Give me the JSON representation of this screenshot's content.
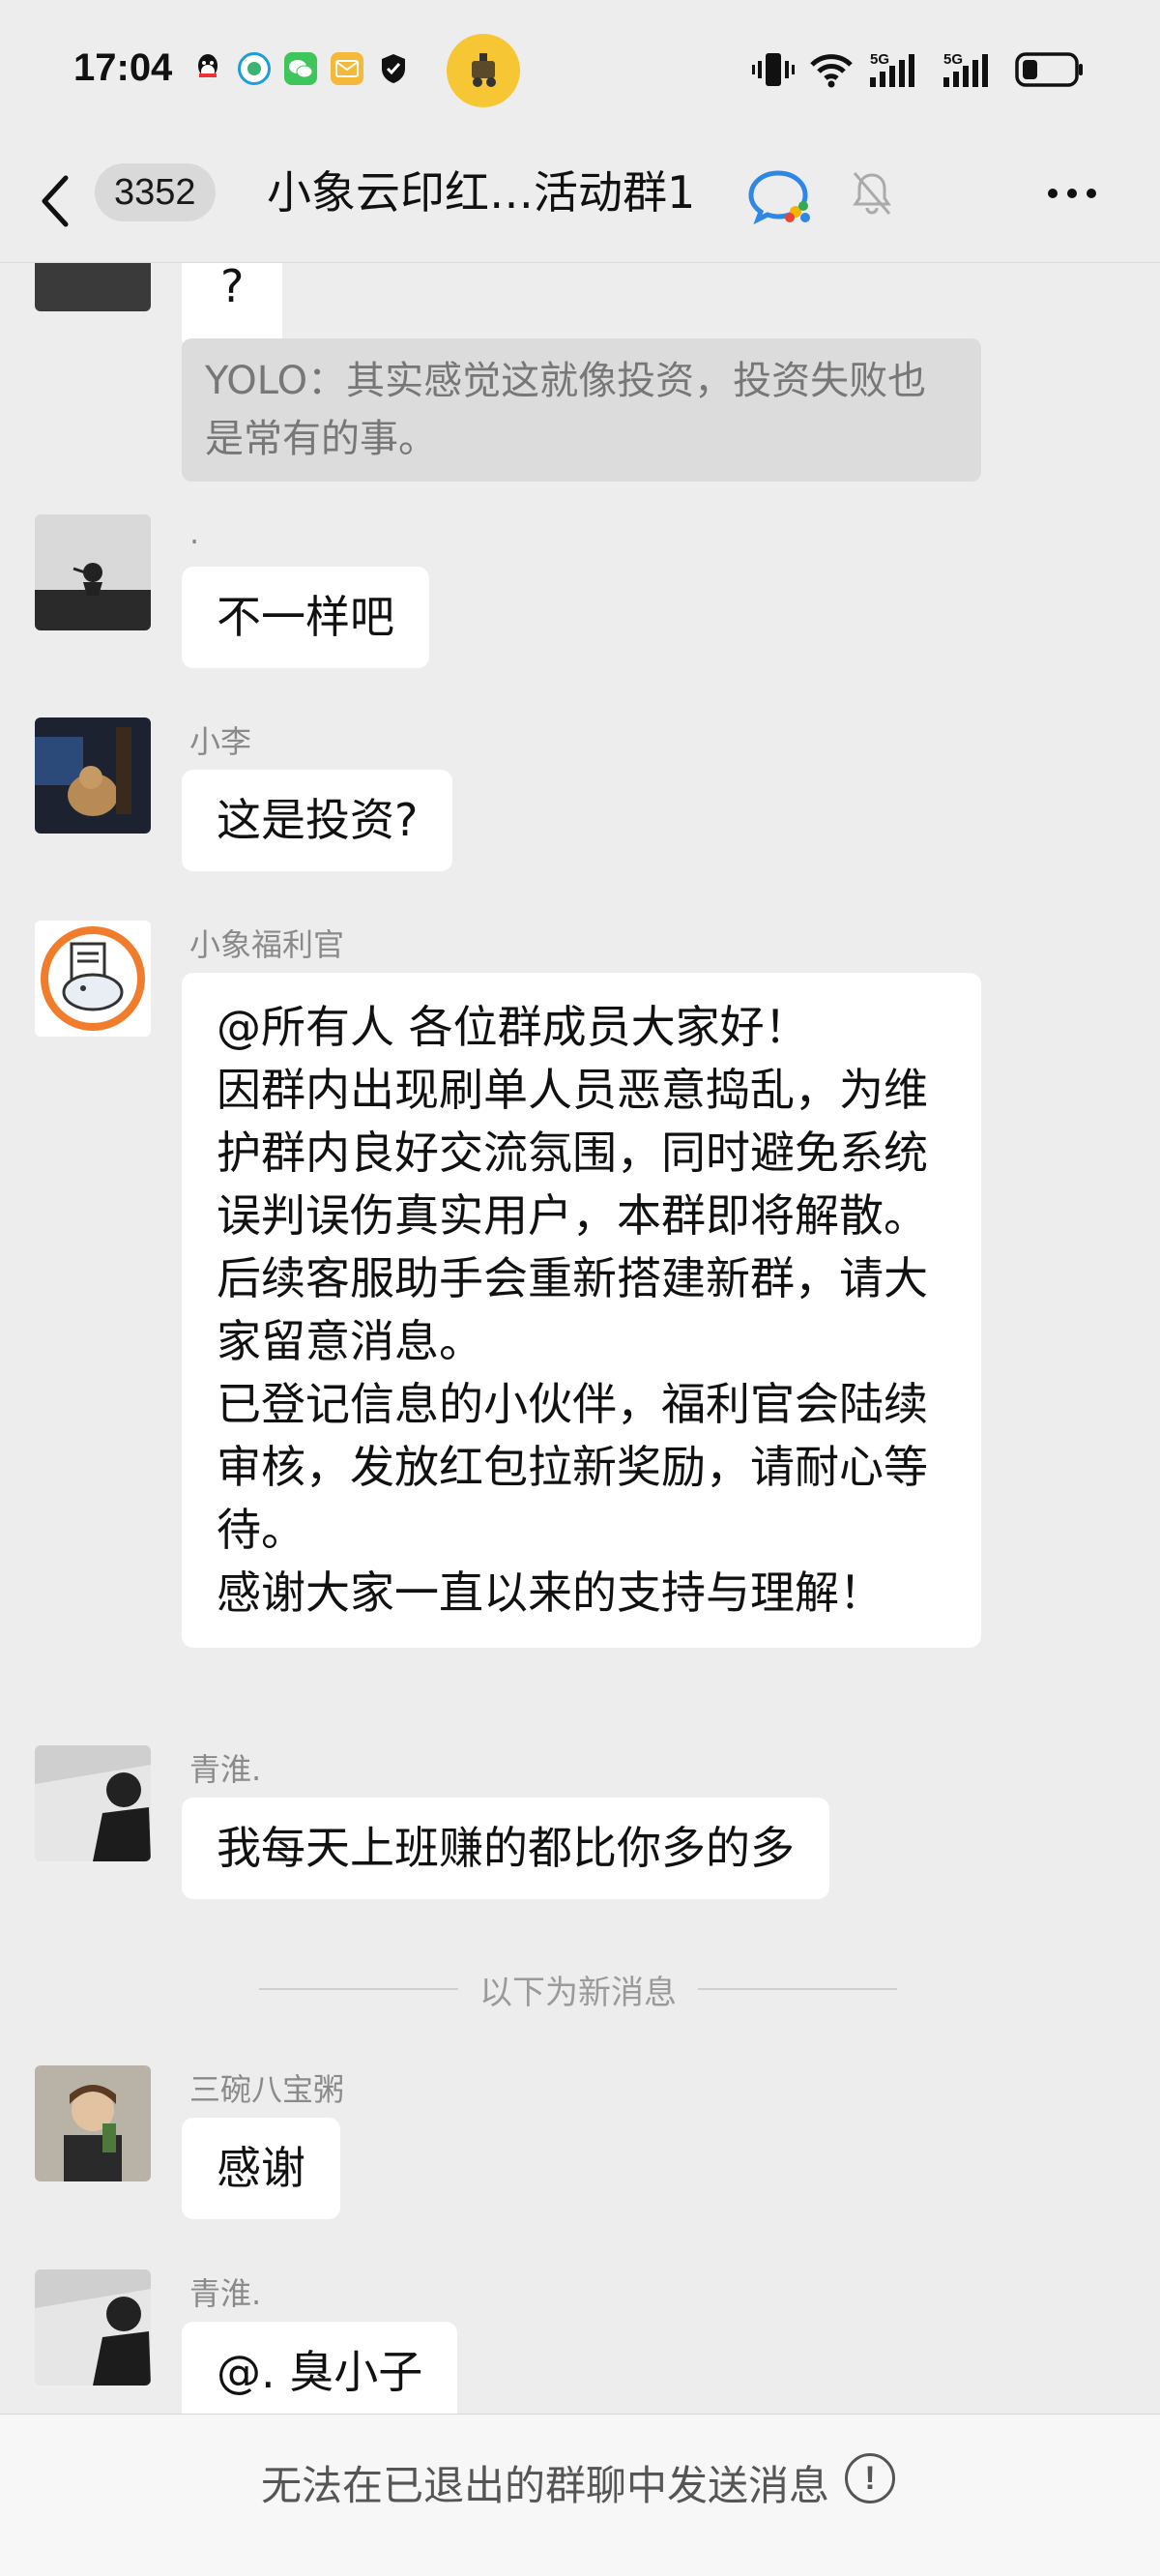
{
  "status_bar": {
    "time": "17:04",
    "notification_icons": [
      "qq-icon",
      "browser-icon",
      "wechat-icon",
      "mail-icon",
      "shield-icon"
    ],
    "network_labels": [
      "5G",
      "5G"
    ],
    "battery_level_percent": 30
  },
  "nav": {
    "unread_count": "3352",
    "title": "小象云印红…活动群1"
  },
  "messages": [
    {
      "type": "bubble",
      "text": "?"
    },
    {
      "type": "quote",
      "text": "YOLO：其实感觉这就像投资，投资失败也是常有的事。"
    },
    {
      "sender": ".",
      "text": "不一样吧"
    },
    {
      "sender": "小李",
      "text": "这是投资?"
    },
    {
      "sender": "小象福利官",
      "lines": [
        "@所有人 各位群成员大家好！",
        "因群内出现刷单人员恶意捣乱，为维护群内良好交流氛围，同时避免系统误判误伤真实用户，本群即将解散。",
        "后续客服助手会重新搭建新群，请大家留意消息。",
        "已登记信息的小伙伴，福利官会陆续审核，发放红包拉新奖励，请耐心等待。",
        "感谢大家一直以来的支持与理解！"
      ]
    },
    {
      "sender": "青淮.",
      "text": "我每天上班赚的都比你多的多"
    },
    {
      "divider": "以下为新消息"
    },
    {
      "sender": "三碗八宝粥",
      "text": "感谢"
    },
    {
      "sender": "青淮.",
      "text": "@. 臭小子"
    }
  ],
  "bottom_bar": {
    "text": "无法在已退出的群聊中发送消息",
    "info_icon": "!"
  },
  "colors": {
    "background": "#ededed",
    "bubble": "#ffffff",
    "quote": "#dcdcdc",
    "muted_text": "#8a8a8a"
  }
}
